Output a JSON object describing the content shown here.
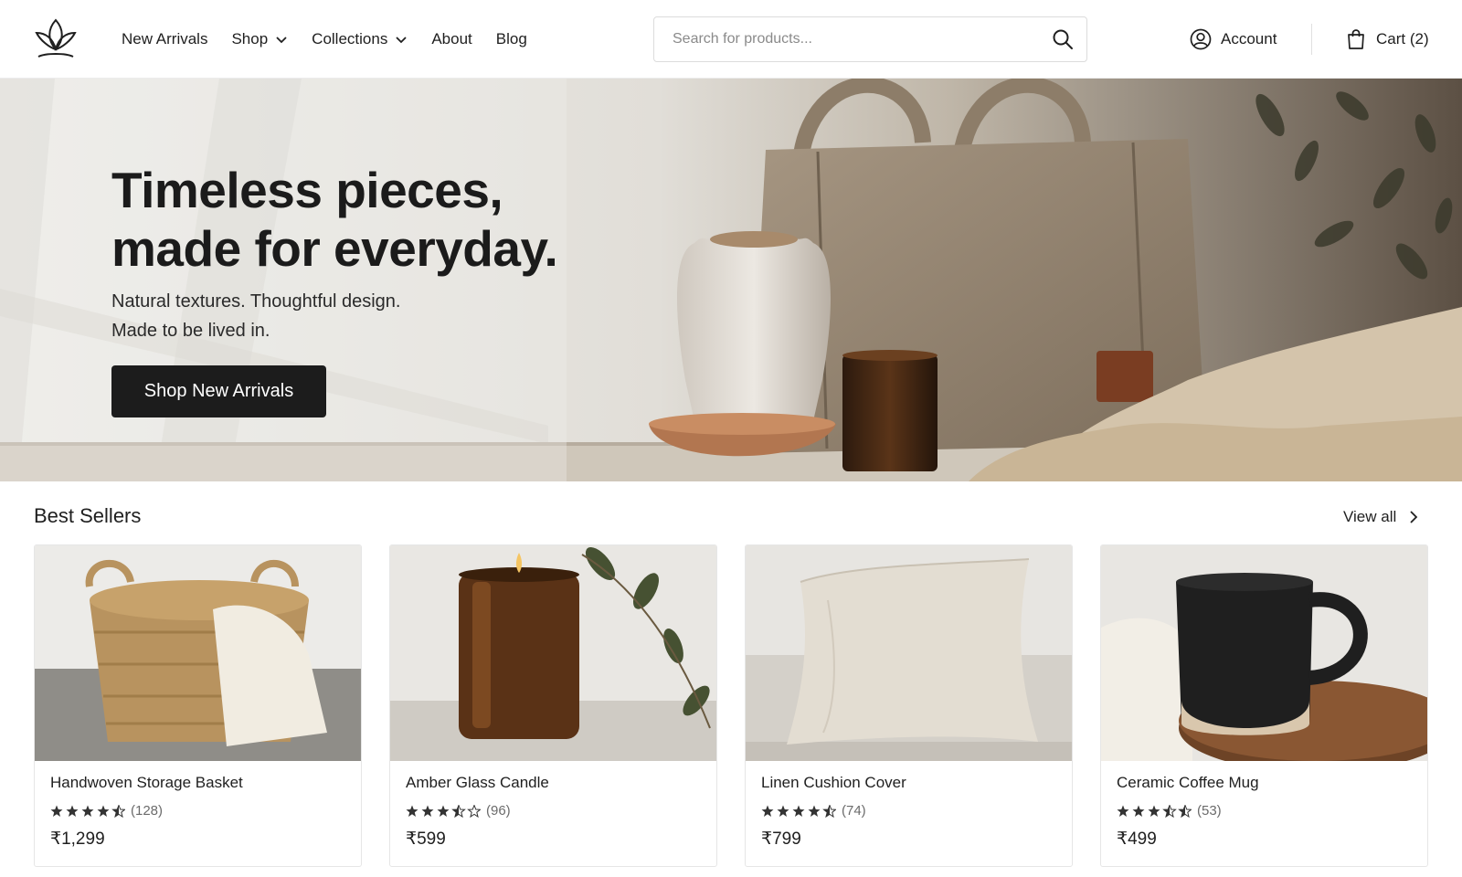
{
  "header": {
    "nav": [
      {
        "label": "New Arrivals"
      },
      {
        "label": "Shop",
        "dropdown": true
      },
      {
        "label": "Collections",
        "dropdown": true
      },
      {
        "label": "About"
      },
      {
        "label": "Blog"
      }
    ],
    "search_placeholder": "Search for products...",
    "account_label": "Account",
    "cart_label": "Cart (2)",
    "icons": [
      "lotus-logo-icon",
      "chevron-down-icon",
      "search-icon",
      "user-circle-icon",
      "shopping-bag-icon"
    ]
  },
  "hero": {
    "title_line1": "Timeless pieces,",
    "title_line2": "made for everyday.",
    "subtitle_line1": "Natural textures. Thoughtful design.",
    "subtitle_line2": "Made to be lived in.",
    "cta_label": "Shop New Arrivals"
  },
  "best_sellers": {
    "title": "Best Sellers",
    "view_all_label": "View all",
    "products": [
      {
        "name": "Handwoven Storage Basket",
        "rating": 4.5,
        "reviews": "(128)",
        "price": "₹1,299"
      },
      {
        "name": "Amber Glass Candle",
        "rating": 3.5,
        "reviews": "(96)",
        "price": "₹599"
      },
      {
        "name": "Linen Cushion Cover",
        "rating": 4.5,
        "reviews": "(74)",
        "price": "₹799"
      },
      {
        "name": "Ceramic Coffee Mug",
        "rating": 4.5,
        "reviews": "(53)",
        "price": "₹499"
      }
    ]
  },
  "colors": {
    "primary_button": "#1c1c1c",
    "text": "#1f1f1f",
    "muted": "#6b6b6b",
    "border": "#e6e6e6"
  }
}
